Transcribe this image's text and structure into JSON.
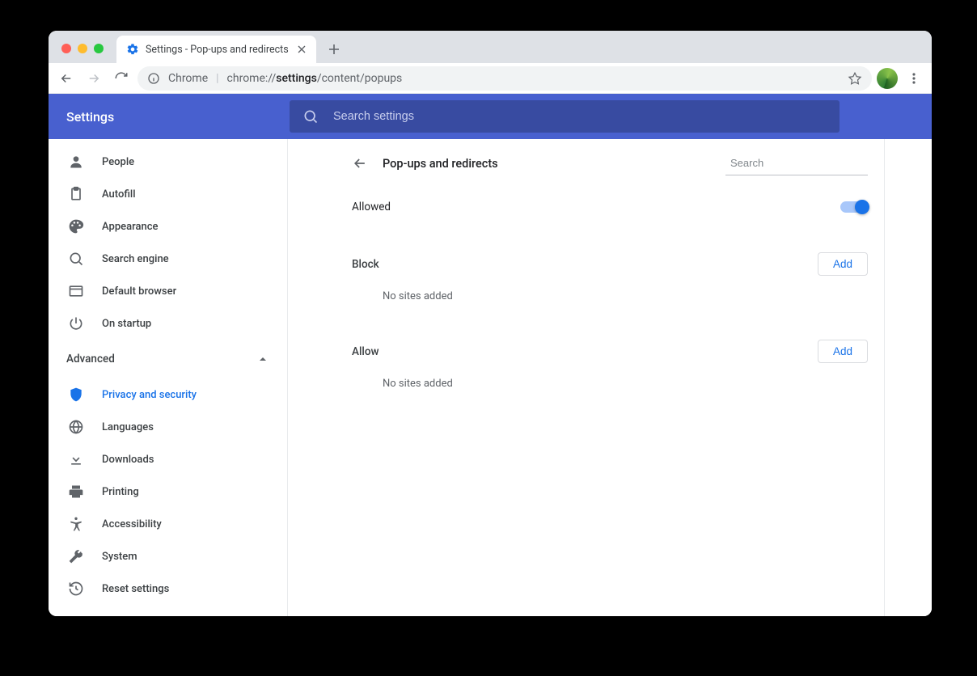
{
  "browser": {
    "tab_title": "Settings - Pop-ups and redirects",
    "omnibox_label": "Chrome",
    "omnibox_url_prefix": "chrome://",
    "omnibox_url_bold": "settings",
    "omnibox_url_suffix": "/content/popups"
  },
  "header": {
    "title": "Settings",
    "search_placeholder": "Search settings"
  },
  "sidebar": {
    "items": [
      {
        "label": "People"
      },
      {
        "label": "Autofill"
      },
      {
        "label": "Appearance"
      },
      {
        "label": "Search engine"
      },
      {
        "label": "Default browser"
      },
      {
        "label": "On startup"
      }
    ],
    "advanced_label": "Advanced",
    "adv_items": [
      {
        "label": "Privacy and security"
      },
      {
        "label": "Languages"
      },
      {
        "label": "Downloads"
      },
      {
        "label": "Printing"
      },
      {
        "label": "Accessibility"
      },
      {
        "label": "System"
      },
      {
        "label": "Reset settings"
      }
    ]
  },
  "page": {
    "title": "Pop-ups and redirects",
    "search_placeholder": "Search",
    "allowed_label": "Allowed",
    "block": {
      "title": "Block",
      "empty": "No sites added",
      "add": "Add"
    },
    "allow": {
      "title": "Allow",
      "empty": "No sites added",
      "add": "Add"
    }
  }
}
